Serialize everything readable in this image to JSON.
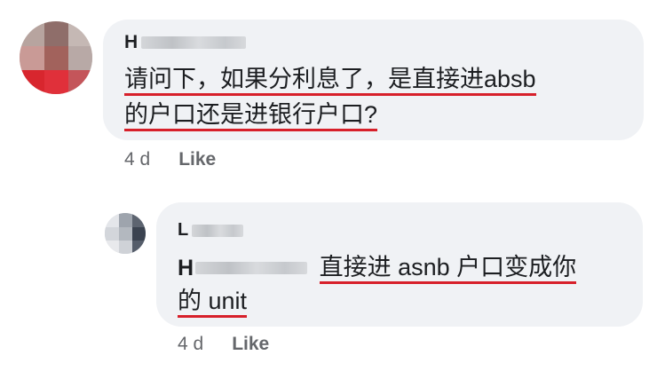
{
  "comments": [
    {
      "author_visible": "H",
      "lines": [
        "请问下，如果分利息了，是直接进absb",
        "的户口还是进银行户口?"
      ],
      "time": "4 d",
      "like_label": "Like"
    },
    {
      "author_visible": "L",
      "tag_visible": "H",
      "lines": [
        "直接进 asnb 户口变成你",
        "的 unit"
      ],
      "time": "4 d",
      "like_label": "Like"
    }
  ],
  "colors": {
    "bubble": "#f0f2f5",
    "underline": "#d7202a",
    "meta": "#65676b"
  }
}
